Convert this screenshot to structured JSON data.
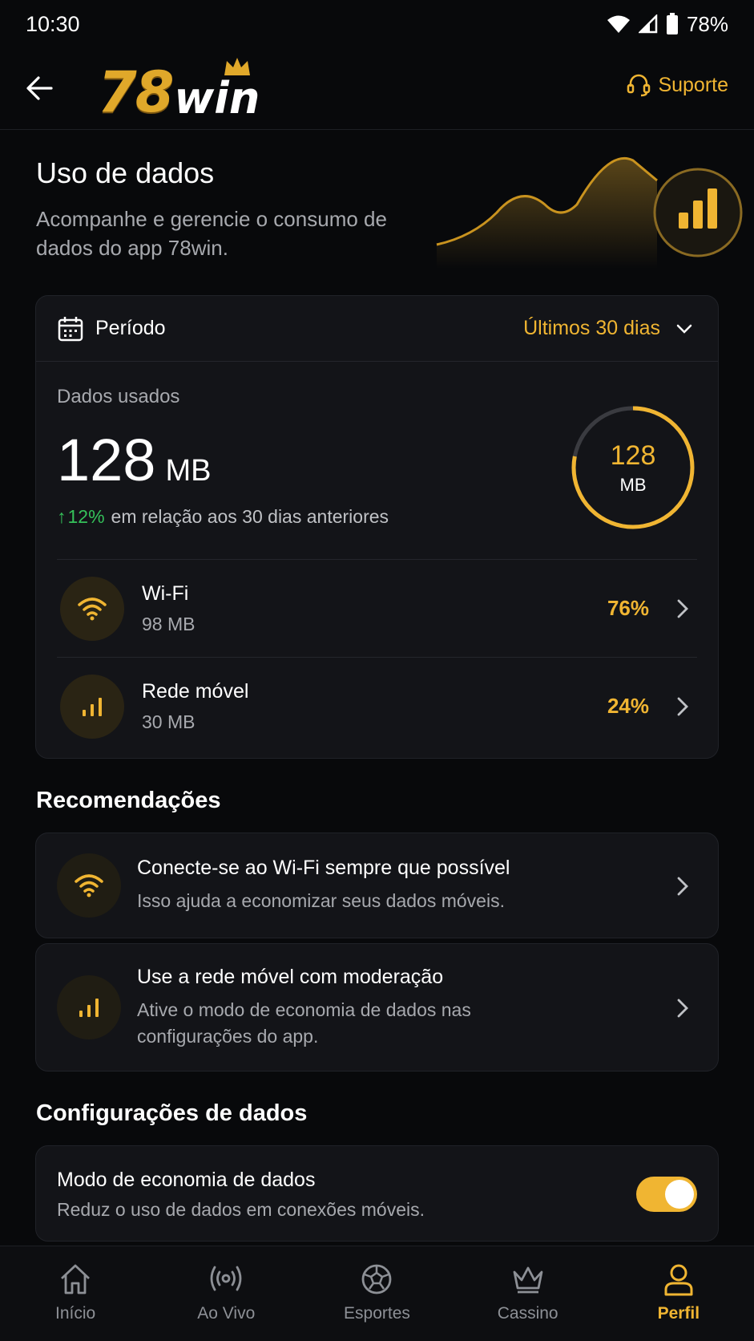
{
  "status": {
    "time": "10:30",
    "battery": "78%"
  },
  "header": {
    "back_icon": "arrow-left-icon",
    "logo_num": "78",
    "logo_word": "win",
    "support_label": "Suporte",
    "support_icon": "headset-icon"
  },
  "hero": {
    "title": "Uso de dados",
    "subtitle": "Acompanhe e gerencie o consumo de dados do app 78win."
  },
  "period": {
    "label": "Período",
    "value": "Últimos 30 dias"
  },
  "usage": {
    "label": "Dados usados",
    "value": "128",
    "unit": "MB",
    "change_arrow": "↑",
    "change_pct": "12%",
    "change_text": "em relação aos 30 dias anteriores",
    "ring_value": "128",
    "ring_unit": "MB",
    "ring_fraction": 0.78
  },
  "connections": [
    {
      "name": "Wi-Fi",
      "size": "98 MB",
      "pct": "76%",
      "icon": "wifi-icon"
    },
    {
      "name": "Rede móvel",
      "size": "30 MB",
      "pct": "24%",
      "icon": "signal-bars-icon"
    }
  ],
  "recommendations": {
    "title": "Recomendações",
    "items": [
      {
        "title": "Conecte-se ao Wi-Fi sempre que possível",
        "desc": "Isso ajuda a economizar seus dados móveis.",
        "icon": "wifi-icon"
      },
      {
        "title": "Use a rede móvel com moderação",
        "desc": "Ative o modo de economia de dados nas configurações do app.",
        "icon": "signal-bars-icon"
      }
    ]
  },
  "settings": {
    "title": "Configurações de dados",
    "saver": {
      "title": "Modo de economia de dados",
      "desc": "Reduz o uso de dados em conexões móveis.",
      "enabled": true
    }
  },
  "nav": [
    {
      "label": "Início",
      "icon": "home-icon"
    },
    {
      "label": "Ao Vivo",
      "icon": "live-broadcast-icon"
    },
    {
      "label": "Esportes",
      "icon": "soccer-ball-icon"
    },
    {
      "label": "Cassino",
      "icon": "crown-icon"
    },
    {
      "label": "Perfil",
      "icon": "user-icon",
      "active": true
    }
  ],
  "colors": {
    "accent": "#f0b532",
    "background": "#08090b",
    "card": "#131418",
    "positive": "#35c15a"
  }
}
